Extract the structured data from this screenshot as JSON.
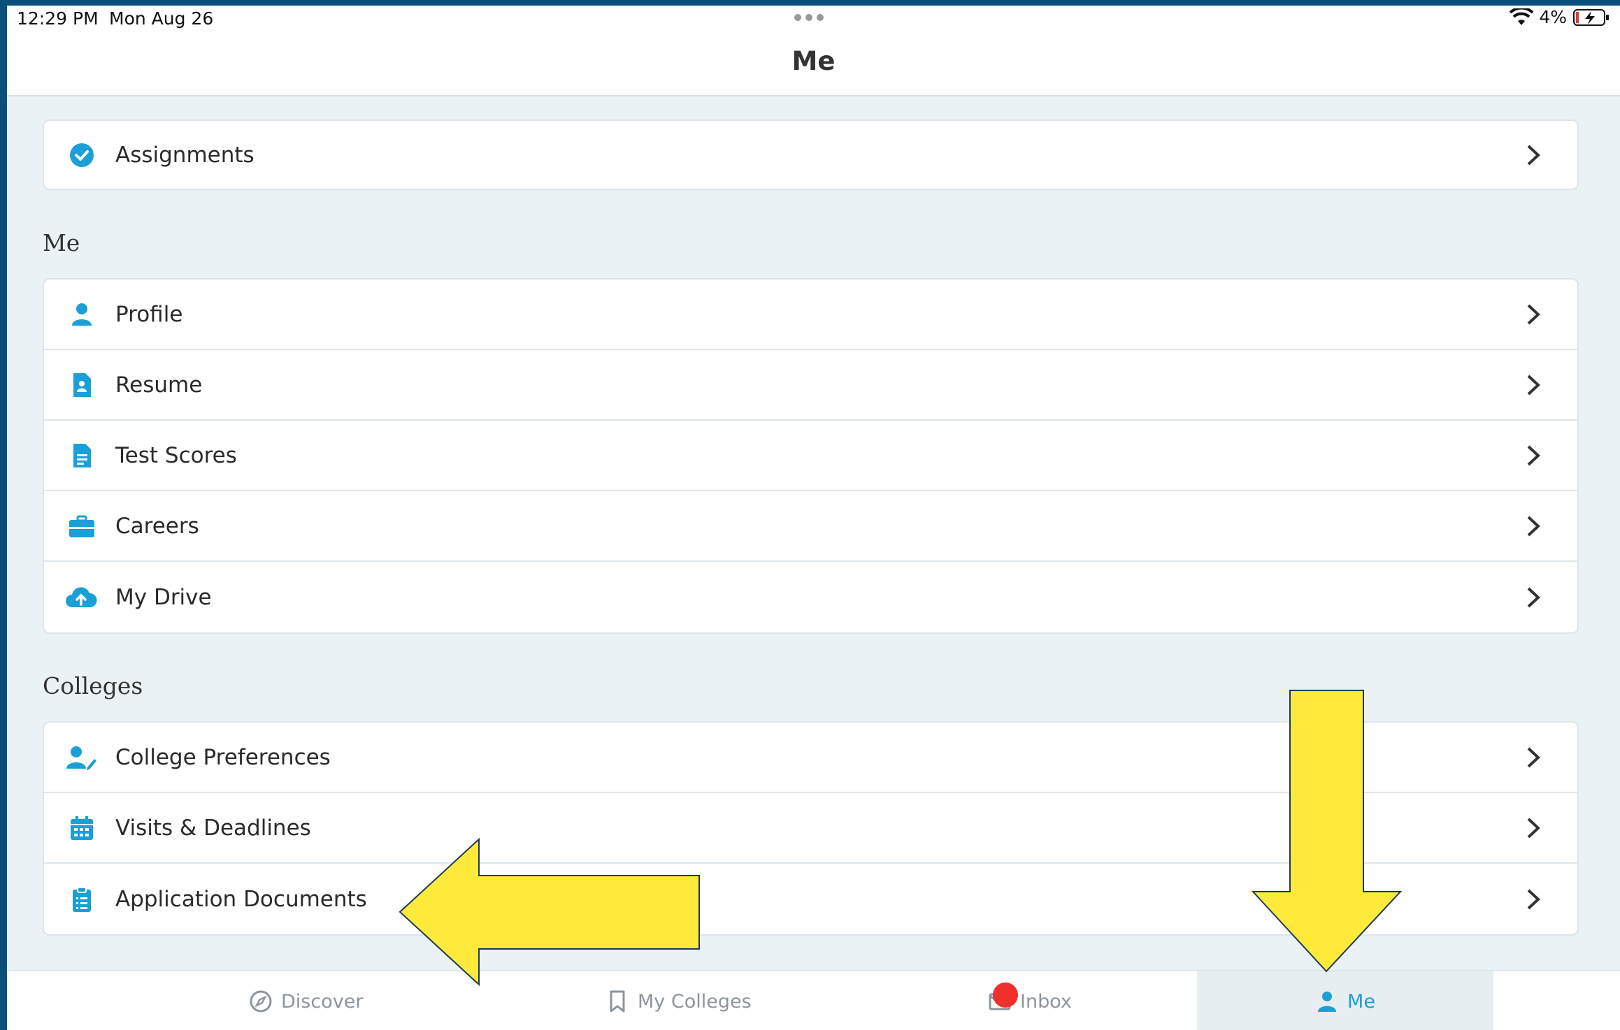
{
  "status": {
    "time": "12:29 PM",
    "date": "Mon Aug 26",
    "battery": "4%"
  },
  "header": {
    "title": "Me"
  },
  "colors": {
    "accent": "#1a9fd6",
    "badge": "#f0302a",
    "arrow": "#ffe93b"
  },
  "assignments": {
    "label": "Assignments",
    "icon": "check-circle-icon"
  },
  "me_section": {
    "title": "Me",
    "items": [
      {
        "label": "Profile",
        "icon": "person-icon"
      },
      {
        "label": "Resume",
        "icon": "resume-icon"
      },
      {
        "label": "Test Scores",
        "icon": "document-icon"
      },
      {
        "label": "Careers",
        "icon": "briefcase-icon"
      },
      {
        "label": "My Drive",
        "icon": "cloud-upload-icon"
      }
    ]
  },
  "colleges_section": {
    "title": "Colleges",
    "items": [
      {
        "label": "College Preferences",
        "icon": "user-edit-icon"
      },
      {
        "label": "Visits & Deadlines",
        "icon": "calendar-icon"
      },
      {
        "label": "Application Documents",
        "icon": "clipboard-icon"
      }
    ]
  },
  "tabs": [
    {
      "label": "Discover",
      "icon": "compass-icon"
    },
    {
      "label": "My Colleges",
      "icon": "bookmark-icon"
    },
    {
      "label": "Inbox",
      "icon": "envelope-icon"
    },
    {
      "label": "Me",
      "icon": "person-icon",
      "active": true
    }
  ]
}
